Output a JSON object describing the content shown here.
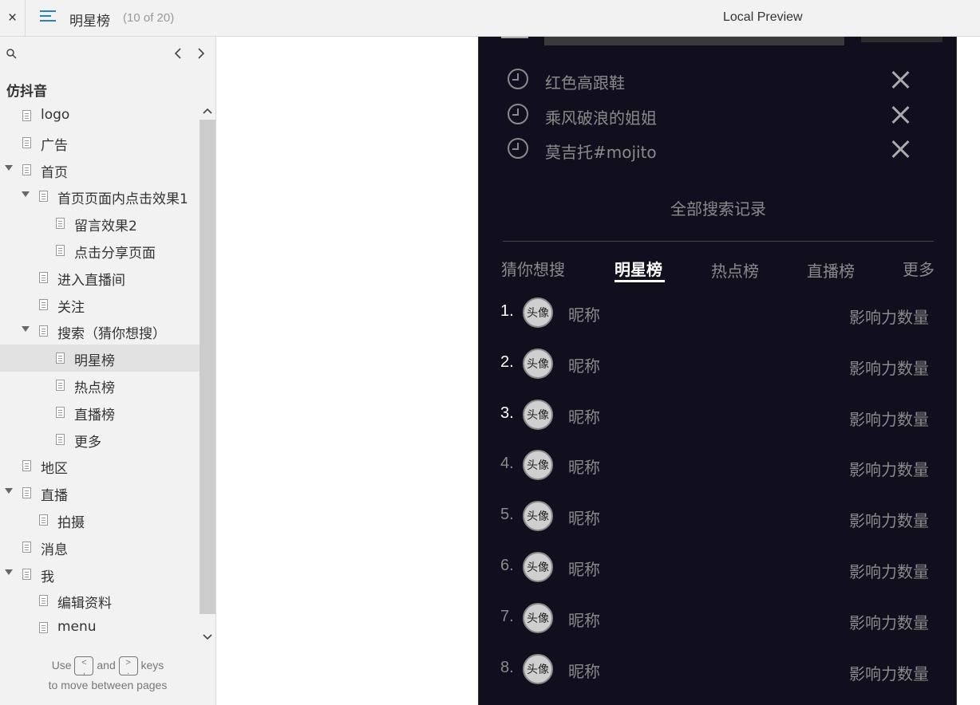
{
  "topbar": {
    "close_glyph": "×",
    "page_title": "明星榜",
    "page_count": "(10 of 20)",
    "preview_title": "Local Preview"
  },
  "sidebar": {
    "project_title": "仿抖音",
    "tree": [
      {
        "label": "logo",
        "level": 0,
        "expanded": false,
        "selected": false
      },
      {
        "label": "广告",
        "level": 0,
        "expanded": false,
        "selected": false
      },
      {
        "label": "首页",
        "level": 0,
        "expanded": true,
        "selected": false
      },
      {
        "label": "首页页面内点击效果1",
        "level": 1,
        "expanded": true,
        "selected": false
      },
      {
        "label": "留言效果2",
        "level": 2,
        "expanded": false,
        "selected": false
      },
      {
        "label": "点击分享页面",
        "level": 2,
        "expanded": false,
        "selected": false
      },
      {
        "label": "进入直播间",
        "level": 1,
        "expanded": false,
        "selected": false
      },
      {
        "label": "关注",
        "level": 1,
        "expanded": false,
        "selected": false
      },
      {
        "label": "搜索（猜你想搜）",
        "level": 1,
        "expanded": true,
        "selected": false
      },
      {
        "label": "明星榜",
        "level": 2,
        "expanded": false,
        "selected": true
      },
      {
        "label": "热点榜",
        "level": 2,
        "expanded": false,
        "selected": false
      },
      {
        "label": "直播榜",
        "level": 2,
        "expanded": false,
        "selected": false
      },
      {
        "label": "更多",
        "level": 2,
        "expanded": false,
        "selected": false
      },
      {
        "label": "地区",
        "level": 0,
        "expanded": false,
        "selected": false
      },
      {
        "label": "直播",
        "level": 0,
        "expanded": true,
        "selected": false
      },
      {
        "label": "拍摄",
        "level": 1,
        "expanded": false,
        "selected": false
      },
      {
        "label": "消息",
        "level": 0,
        "expanded": false,
        "selected": false
      },
      {
        "label": "我",
        "level": 0,
        "expanded": true,
        "selected": false
      },
      {
        "label": "编辑资料",
        "level": 1,
        "expanded": false,
        "selected": false
      },
      {
        "label": "menu",
        "level": 1,
        "expanded": false,
        "selected": false
      }
    ],
    "hint": {
      "use": "Use",
      "key_prev": "<\n,",
      "and": "and",
      "key_next": ">\n.",
      "keys": "keys",
      "line2": "to move between pages"
    }
  },
  "preview": {
    "history": [
      {
        "text": "红色高跟鞋"
      },
      {
        "text": "乘风破浪的姐姐"
      },
      {
        "text": "莫吉托#mojito"
      }
    ],
    "all_history_label": "全部搜索记录",
    "tabs": [
      {
        "label": "猜你想搜",
        "active": false
      },
      {
        "label": "明星榜",
        "active": true
      },
      {
        "label": "热点榜",
        "active": false
      },
      {
        "label": "直播榜",
        "active": false
      },
      {
        "label": "更多",
        "active": false
      }
    ],
    "ranking": [
      {
        "rank": "1.",
        "avatar": "头像",
        "nickname": "昵称",
        "influence": "影响力数量",
        "highlight": true
      },
      {
        "rank": "2.",
        "avatar": "头像",
        "nickname": "昵称",
        "influence": "影响力数量",
        "highlight": true
      },
      {
        "rank": "3.",
        "avatar": "头像",
        "nickname": "昵称",
        "influence": "影响力数量",
        "highlight": true
      },
      {
        "rank": "4.",
        "avatar": "头像",
        "nickname": "昵称",
        "influence": "影响力数量",
        "highlight": false
      },
      {
        "rank": "5.",
        "avatar": "头像",
        "nickname": "昵称",
        "influence": "影响力数量",
        "highlight": false
      },
      {
        "rank": "6.",
        "avatar": "头像",
        "nickname": "昵称",
        "influence": "影响力数量",
        "highlight": false
      },
      {
        "rank": "7.",
        "avatar": "头像",
        "nickname": "昵称",
        "influence": "影响力数量",
        "highlight": false
      },
      {
        "rank": "8.",
        "avatar": "头像",
        "nickname": "昵称",
        "influence": "影响力数量",
        "highlight": false
      }
    ]
  },
  "colors": {
    "accent": "#2a7fc9",
    "phone_bg": "#110f1e",
    "muted_text": "#8a8a8a",
    "sidebar_bg": "#f2f2f2",
    "selected_bg": "#e2e2e2"
  },
  "icons": {
    "close": "close-icon",
    "menu": "hamburger-menu-icon",
    "search": "search-icon",
    "prev": "chevron-left-icon",
    "next": "chevron-right-icon",
    "page": "page-icon",
    "history": "clock-icon",
    "remove": "x-icon"
  }
}
